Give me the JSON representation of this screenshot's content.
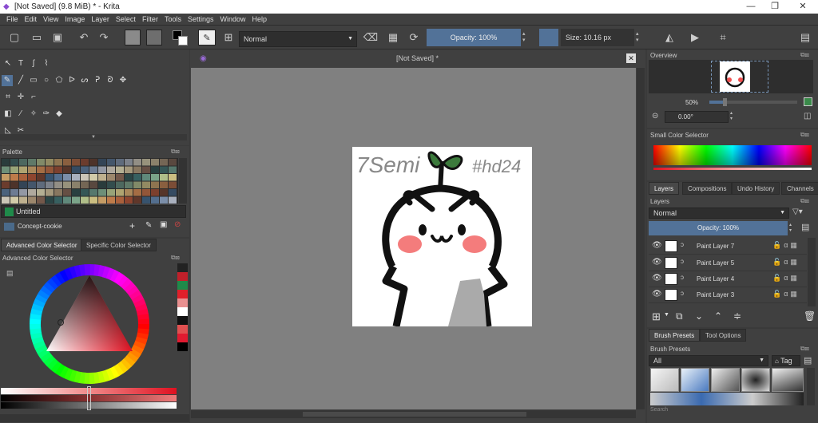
{
  "app": {
    "title": "[Not Saved]  (9.8 MiB)  * - Krita",
    "window_buttons": [
      "—",
      "❐",
      "✕"
    ]
  },
  "menu": [
    "File",
    "Edit",
    "View",
    "Image",
    "Layer",
    "Select",
    "Filter",
    "Tools",
    "Settings",
    "Window",
    "Help"
  ],
  "toolbar": {
    "blend_mode": "Normal",
    "opacity": "Opacity:  100%",
    "size": "Size:  10.16 px"
  },
  "canvas": {
    "doc_title": "[Not Saved]  *",
    "art_text_1": "7Semi",
    "art_text_2": "#hd24"
  },
  "palette": {
    "title": "Palette",
    "name": "Untitled",
    "resource": "Concept-cookie"
  },
  "color_selector": {
    "tabs": [
      "Advanced Color Selector",
      "Specific Color Selector"
    ],
    "title": "Advanced Color Selector"
  },
  "overview": {
    "title": "Overview",
    "zoom": "50%",
    "rotation": "0.00°"
  },
  "small_color": {
    "title": "Small Color Selector"
  },
  "layers_docker": {
    "tabs": [
      "Layers",
      "Compositions",
      "Undo History",
      "Channels"
    ],
    "title": "Layers",
    "blend": "Normal",
    "opacity": "Opacity:  100%",
    "layers": [
      {
        "name": "Paint Layer 7"
      },
      {
        "name": "Paint Layer 5"
      },
      {
        "name": "Paint Layer 4"
      },
      {
        "name": "Paint Layer 3"
      }
    ]
  },
  "brush_docker": {
    "tabs": [
      "Brush Presets",
      "Tool Options"
    ],
    "title": "Brush Presets",
    "filter": "All",
    "tag": "Tag",
    "search": "Search"
  },
  "colors": {
    "accent": "#527298",
    "panel": "#404040",
    "canvas_bg": "#808080"
  }
}
